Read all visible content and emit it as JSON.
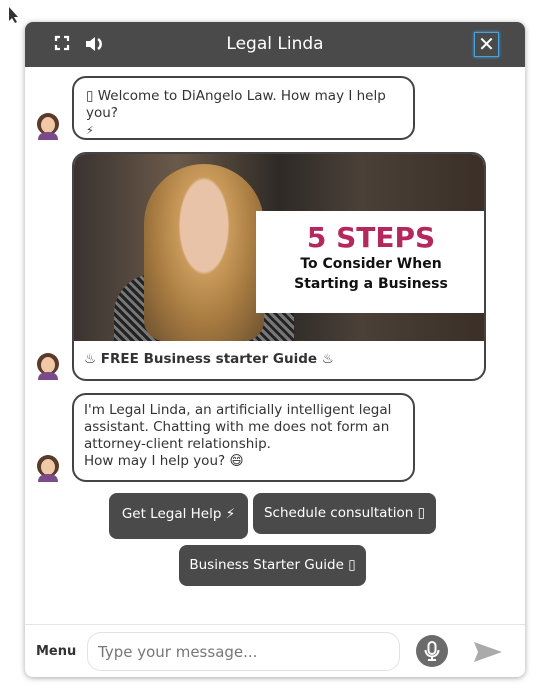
{
  "header": {
    "title": "Legal Linda",
    "fullscreen_icon": "fullscreen-icon",
    "sound_icon": "speaker-icon",
    "close_label": "✕"
  },
  "messages": [
    {
      "text": "▯ Welcome to DiAngelo Law. How may I help you?",
      "emoji": "⚡"
    },
    {
      "type": "image-card",
      "image_heading": "5 STEPS",
      "image_line1": "To Consider When",
      "image_line2": "Starting a Business",
      "caption": "♨ FREE Business starter Guide ♨"
    },
    {
      "lines": [
        "I'm Legal Linda, an artificially intelligent legal",
        "assistant. Chatting with me does not form an",
        "attorney-client relationship.",
        "How may I help you? 😄"
      ]
    }
  ],
  "quick_replies": [
    "Get Legal Help ⚡",
    "Schedule consultation ▯",
    "Business Starter Guide ▯"
  ],
  "footer": {
    "menu_label": "Menu",
    "input_placeholder": "Type your message...",
    "input_value": ""
  },
  "colors": {
    "header": "#4a4a4a",
    "button": "#4a4a4a",
    "accent_heading": "#b5285e",
    "close_focus": "#4aa3df"
  }
}
